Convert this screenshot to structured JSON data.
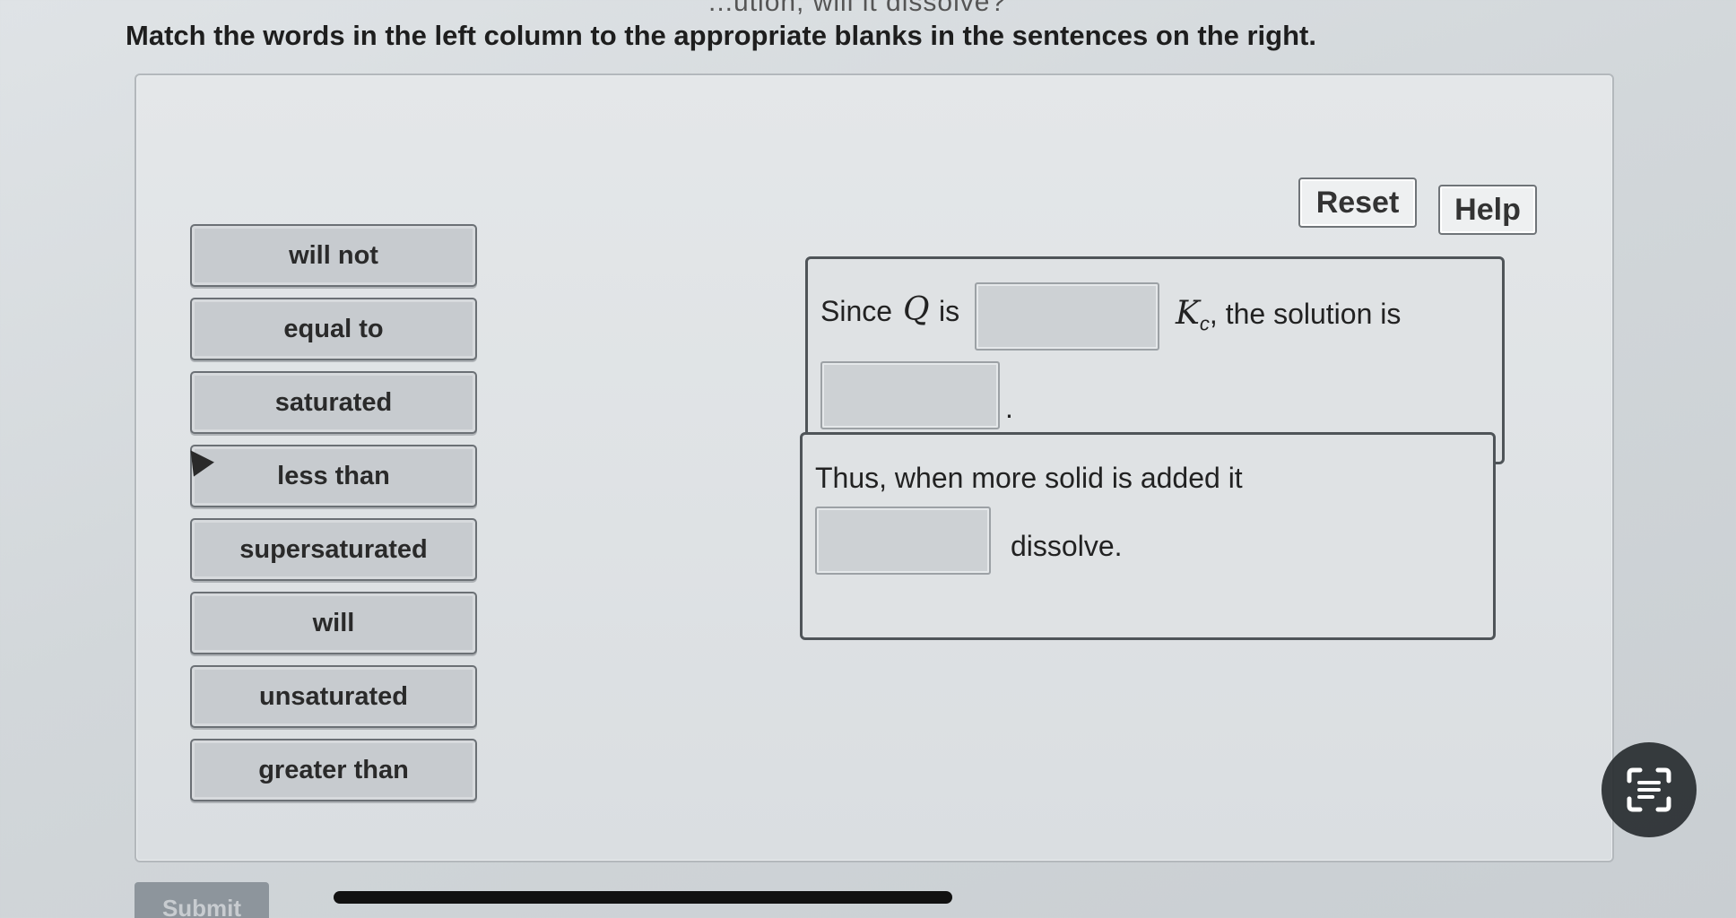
{
  "header": {
    "question_fragment": "...ution, will it dissolve?",
    "instruction": "Match the words in the left column to the appropriate blanks in the sentences on the right."
  },
  "toolbar": {
    "reset_label": "Reset",
    "help_label": "Help"
  },
  "word_bank": [
    "will not",
    "equal to",
    "saturated",
    "less than",
    "supersaturated",
    "will",
    "unsaturated",
    "greater than"
  ],
  "sentences": {
    "s1": {
      "part1": "Since",
      "var_q": "Q",
      "part2": "is",
      "var_k": "K",
      "var_k_sub": "c",
      "part3": ", the solution is",
      "part4": "."
    },
    "s2": {
      "part1": "Thus, when more solid is added it",
      "part2": "dissolve."
    }
  },
  "footer": {
    "submit_label": "Submit"
  }
}
